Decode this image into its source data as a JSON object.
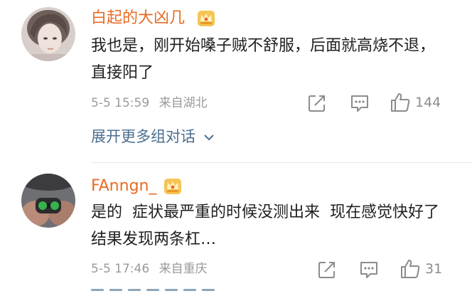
{
  "comments": [
    {
      "username": "白起的大凶几",
      "text": "我也是，刚开始嗓子贼不舒服，后面就高烧不退，直接阳了",
      "time": "5-5 15:59",
      "location": "来自湖北",
      "likes": "144"
    },
    {
      "username": "FAnngn_",
      "text": "是的  症状最严重的时候没测出来  现在感觉快好了结果发现两条杠…",
      "time": "5-5 17:46",
      "location": "来自重庆",
      "likes": "31"
    }
  ],
  "expand_label": "展开更多组对话",
  "icons": {
    "badge": "crown-badge-icon",
    "share": "share-icon",
    "reply": "comment-icon",
    "like": "thumbs-up-icon",
    "expand": "chevron-down-icon"
  },
  "colors": {
    "username": "#e86b23",
    "link": "#4a6e8f",
    "meta": "#9a9a9a",
    "body": "#1f1f1f",
    "icon": "#8c8c8c"
  }
}
